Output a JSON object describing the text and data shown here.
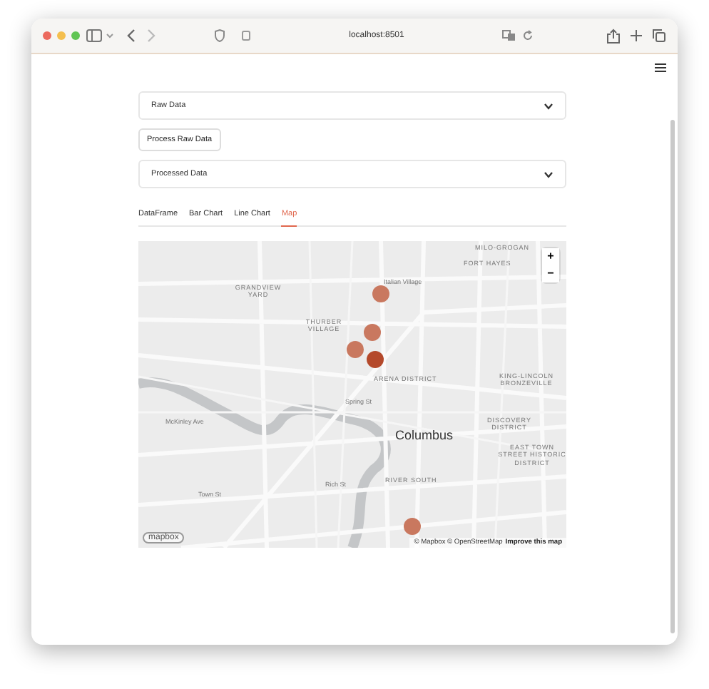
{
  "browser": {
    "url": "localhost:8501"
  },
  "sections": [
    {
      "kind": "expander",
      "label": "Raw Data",
      "expanded": false
    },
    {
      "kind": "button",
      "label": "Process Raw Data"
    },
    {
      "kind": "expander",
      "label": "Processed Data",
      "expanded": false
    }
  ],
  "tabs": [
    {
      "label": "DataFrame",
      "selected": false
    },
    {
      "label": "Bar Chart",
      "selected": false
    },
    {
      "label": "Line Chart",
      "selected": false
    },
    {
      "label": "Map",
      "selected": true
    }
  ],
  "map": {
    "labels": [
      "Italian Village",
      "GRANDVIEW YARD",
      "THURBER VILLAGE",
      "ARENA DISTRICT",
      "FORT HAYES",
      "MILO-GROGAN",
      "KING-LINCOLN BRONZEVILLE",
      "Spring St",
      "McKinley Ave",
      "Columbus",
      "DISCOVERY DISTRICT",
      "EAST TOWN STREET HISTORIC DISTRICT",
      "RIVER SOUTH",
      "Rich St",
      "Town St"
    ],
    "zoom_in": "+",
    "zoom_out": "−",
    "logo": "mapbox",
    "attribution": "© Mapbox © OpenStreetMap",
    "improve_link": "Improve this map"
  }
}
